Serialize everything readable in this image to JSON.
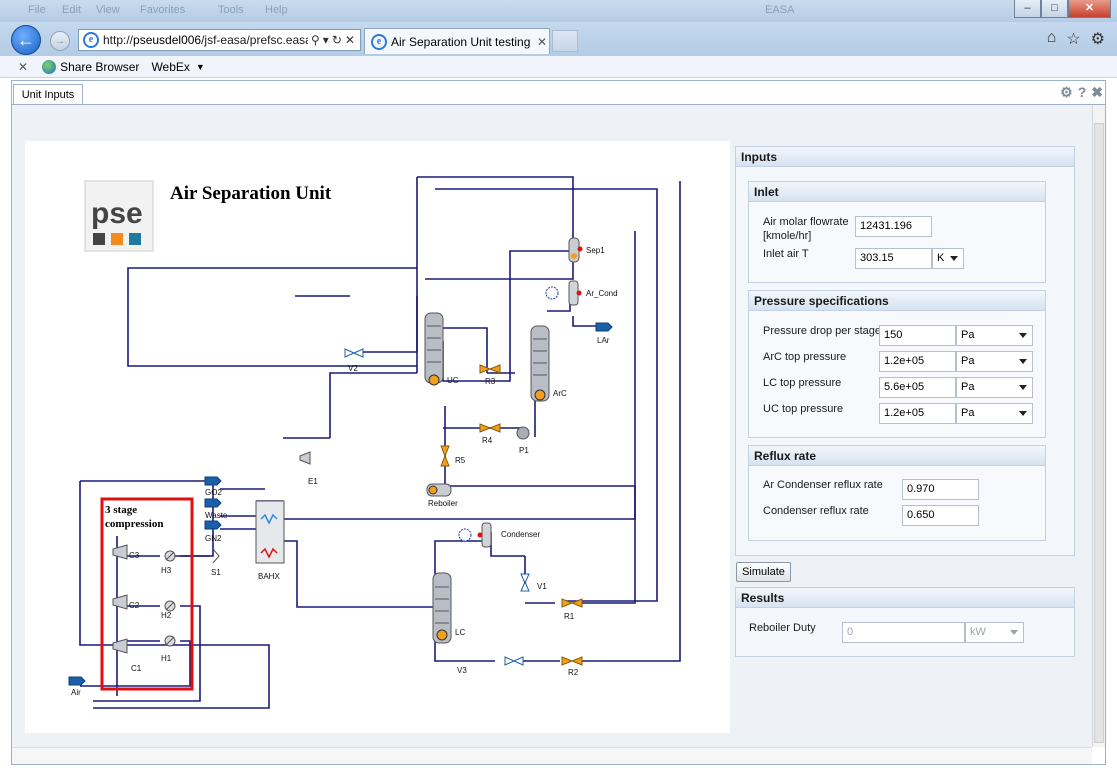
{
  "browser": {
    "ghost_menu": [
      "File",
      "Edit",
      "View",
      "Favorites",
      "Tools",
      "Help"
    ],
    "ghost_title": "EASA",
    "window_buttons": {
      "minimize": "–",
      "maximize": "□",
      "close": "✕"
    },
    "url_prefix": "http://",
    "url_host": "pseusdel006",
    "url_path": "/jsf-easa/prefsc.easa",
    "tab_title": "Air Separation Unit testing ...",
    "tab_close": "✕",
    "favorites": {
      "close": "✕",
      "share_browser": "Share Browser",
      "webex": "WebEx"
    }
  },
  "app": {
    "tab": "Unit Inputs",
    "icons": [
      "gear-icon",
      "help-icon",
      "close-icon"
    ]
  },
  "diagram": {
    "title": "Air Separation Unit",
    "logo": "pse",
    "compression_note_line1": "3 stage",
    "compression_note_line2": "compression",
    "labels": {
      "sep1": "Sep1",
      "ar_cond": "Ar_Cond",
      "lar": "LAr",
      "uc": "UC",
      "arc": "ArC",
      "r3": "R3",
      "r4": "R4",
      "r5": "R5",
      "p1": "P1",
      "v2": "V2",
      "e1": "E1",
      "reboiler": "Reboiler",
      "go2": "GO2",
      "waste": "Waste",
      "gn2": "GN2",
      "s1": "S1",
      "bahx": "BAHX",
      "c1": "C1",
      "c2": "C2",
      "c3": "C3",
      "h1": "H1",
      "h2": "H2",
      "h3": "H3",
      "air": "Air",
      "condenser": "Condenser",
      "v1": "V1",
      "r1": "R1",
      "lc": "LC",
      "v3": "V3",
      "r2": "R2"
    }
  },
  "inputs": {
    "title": "Inputs",
    "inlet": {
      "title": "Inlet",
      "air_flow_label_1": "Air molar flowrate",
      "air_flow_label_2": "[kmole/hr]",
      "air_flow_value": "12431.196",
      "air_t_label": "Inlet air T",
      "air_t_value": "303.15",
      "air_t_unit": "K"
    },
    "pressure": {
      "title": "Pressure specifications",
      "rows": [
        {
          "label": "Pressure drop per stage",
          "value": "150",
          "unit": "Pa"
        },
        {
          "label": "ArC top pressure",
          "value": "1.2e+05",
          "unit": "Pa"
        },
        {
          "label": "LC top pressure",
          "value": "5.6e+05",
          "unit": "Pa"
        },
        {
          "label": "UC top pressure",
          "value": "1.2e+05",
          "unit": "Pa"
        }
      ]
    },
    "reflux": {
      "title": "Reflux rate",
      "ar_label": "Ar Condenser reflux rate",
      "ar_value": "0.970",
      "cond_label": "Condenser reflux rate",
      "cond_value": "0.650"
    }
  },
  "simulate_label": "Simulate",
  "results": {
    "title": "Results",
    "duty_label": "Reboiler Duty",
    "duty_value": "0",
    "duty_unit": "kW"
  },
  "colors": {
    "stream": "#1a1a7a",
    "highlight_box": "#e01010",
    "valve": "#f2a01c",
    "accent": "#1a5fc4"
  }
}
